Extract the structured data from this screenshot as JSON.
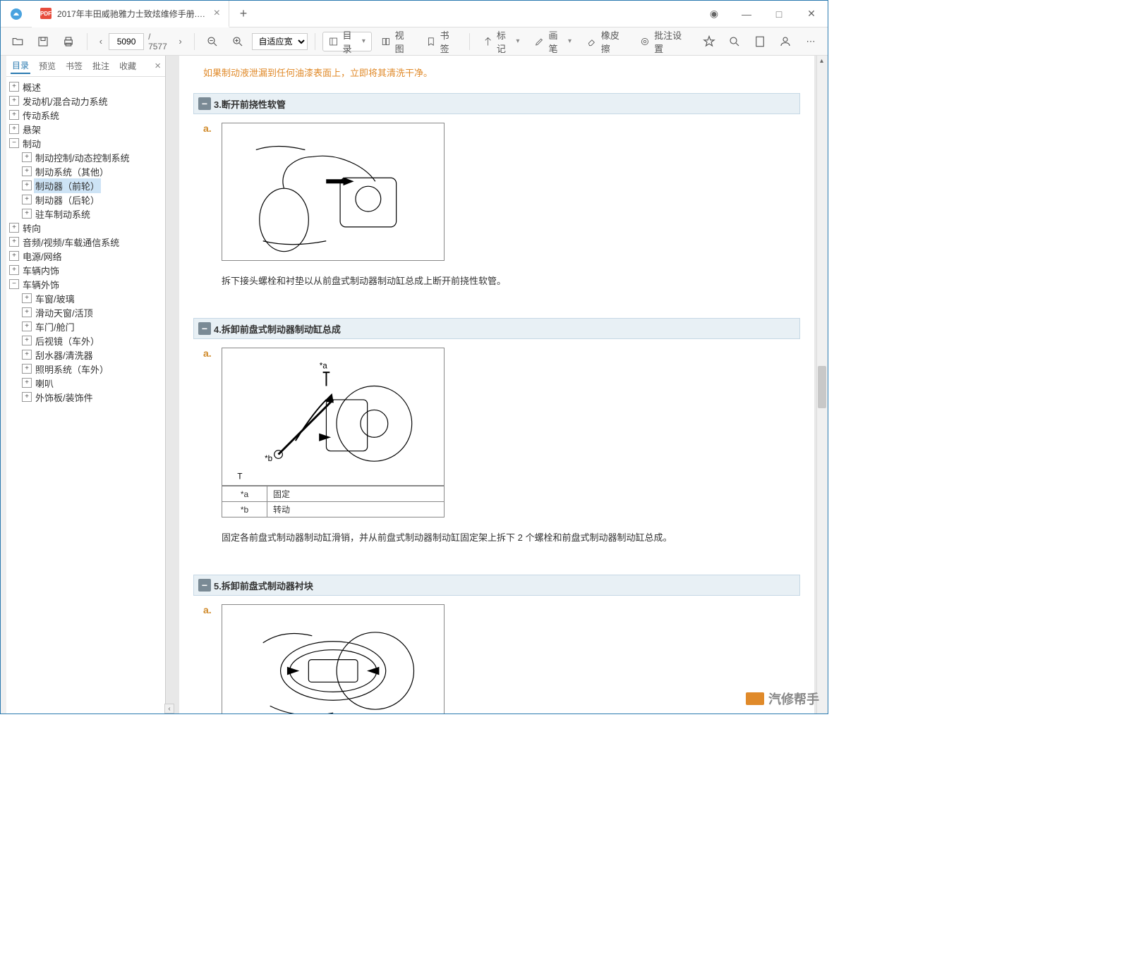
{
  "titlebar": {
    "tab_title": "2017年丰田威驰雅力士致炫维修手册.pdf"
  },
  "toolbar": {
    "page_current": "5090",
    "page_total": "/ 7577",
    "zoom_mode": "自适应宽",
    "btn_outline": "目录",
    "btn_view": "视图",
    "btn_bookmark": "书签",
    "btn_mark": "标记",
    "btn_pen": "画笔",
    "btn_eraser": "橡皮擦",
    "btn_annot": "批注设置"
  },
  "side_tabs": {
    "t1": "目录",
    "t2": "预览",
    "t3": "书签",
    "t4": "批注",
    "t5": "收藏"
  },
  "outline": [
    {
      "level": 0,
      "state": "plus",
      "label": "概述"
    },
    {
      "level": 0,
      "state": "plus",
      "label": "发动机/混合动力系统"
    },
    {
      "level": 0,
      "state": "plus",
      "label": "传动系统"
    },
    {
      "level": 0,
      "state": "plus",
      "label": "悬架"
    },
    {
      "level": 0,
      "state": "minus",
      "label": "制动"
    },
    {
      "level": 1,
      "state": "plus",
      "label": "制动控制/动态控制系统"
    },
    {
      "level": 1,
      "state": "plus",
      "label": "制动系统（其他）"
    },
    {
      "level": 1,
      "state": "plus",
      "label": "制动器（前轮）",
      "selected": true
    },
    {
      "level": 1,
      "state": "plus",
      "label": "制动器（后轮）"
    },
    {
      "level": 1,
      "state": "plus",
      "label": "驻车制动系统"
    },
    {
      "level": 0,
      "state": "plus",
      "label": "转向"
    },
    {
      "level": 0,
      "state": "plus",
      "label": "音频/视频/车载通信系统"
    },
    {
      "level": 0,
      "state": "plus",
      "label": "电源/网络"
    },
    {
      "level": 0,
      "state": "plus",
      "label": "车辆内饰"
    },
    {
      "level": 0,
      "state": "minus",
      "label": "车辆外饰"
    },
    {
      "level": 1,
      "state": "plus",
      "label": "车窗/玻璃"
    },
    {
      "level": 1,
      "state": "plus",
      "label": "滑动天窗/活顶"
    },
    {
      "level": 1,
      "state": "plus",
      "label": "车门/舱门"
    },
    {
      "level": 1,
      "state": "plus",
      "label": "后视镜（车外）"
    },
    {
      "level": 1,
      "state": "plus",
      "label": "刮水器/清洗器"
    },
    {
      "level": 1,
      "state": "plus",
      "label": "照明系统（车外）"
    },
    {
      "level": 1,
      "state": "plus",
      "label": "喇叭"
    },
    {
      "level": 1,
      "state": "plus",
      "label": "外饰板/装饰件"
    }
  ],
  "content": {
    "warning": "如果制动液泄漏到任何油漆表面上，立即将其清洗干净。",
    "sect3": {
      "title": "3.断开前挠性软管",
      "sub": "a.",
      "text": "拆下接头螺栓和衬垫以从前盘式制动器制动缸总成上断开前挠性软管。"
    },
    "sect4": {
      "title": "4.拆卸前盘式制动器制动缸总成",
      "sub": "a.",
      "legend_a_key": "*a",
      "legend_a_val": "固定",
      "legend_b_key": "*b",
      "legend_b_val": "转动",
      "fig_a": "*a",
      "fig_b": "*b",
      "fig_t": "T",
      "text": "固定各前盘式制动器制动缸滑销，并从前盘式制动器制动缸固定架上拆下 2 个螺栓和前盘式制动器制动缸总成。"
    },
    "sect5": {
      "title": "5.拆卸前盘式制动器衬块",
      "sub": "a."
    }
  },
  "watermark": "汽修帮手"
}
